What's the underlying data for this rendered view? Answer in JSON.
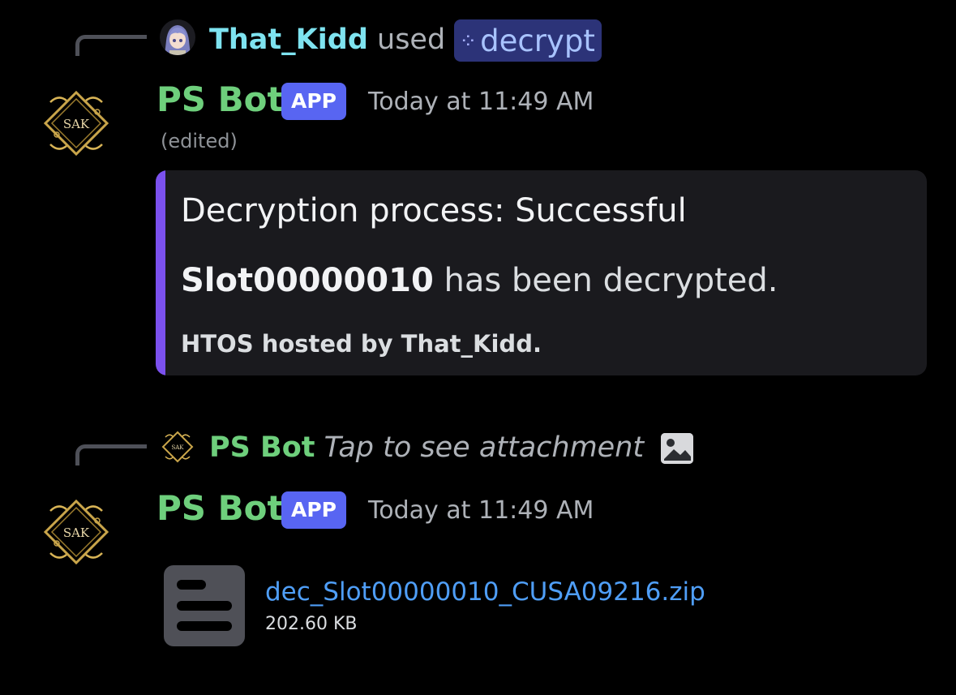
{
  "messages": [
    {
      "reply": {
        "user": "That_Kidd",
        "used_text": "used",
        "command": "decrypt",
        "command_icon": "app-command-icon",
        "user_color": "#7ee3f0"
      },
      "author": "PS Bot",
      "badge": "APP",
      "timestamp": "Today at 11:49 AM",
      "edited": "(edited)",
      "embed": {
        "accent_color": "#7b51ee",
        "title": "Decryption process: Successful",
        "desc_bold": "Slot00000010",
        "desc_rest": " has been decrypted.",
        "footer": "HTOS hosted by That_Kidd."
      }
    },
    {
      "reply": {
        "user": "PS Bot",
        "preview": "Tap to see attachment",
        "preview_icon": "image-icon",
        "user_color": "#6ecf7c"
      },
      "author": "PS Bot",
      "badge": "APP",
      "timestamp": "Today at 11:49 AM",
      "attachment": {
        "file_name": "dec_Slot00000010_CUSA09216.zip",
        "file_size": "202.60 KB",
        "icon": "file-document-icon",
        "link_color": "#4f9ef7"
      }
    }
  ],
  "colors": {
    "background": "#000000",
    "bot_name": "#6ecf7c",
    "app_badge": "#5865f2",
    "command_pill": "#2c3378"
  }
}
